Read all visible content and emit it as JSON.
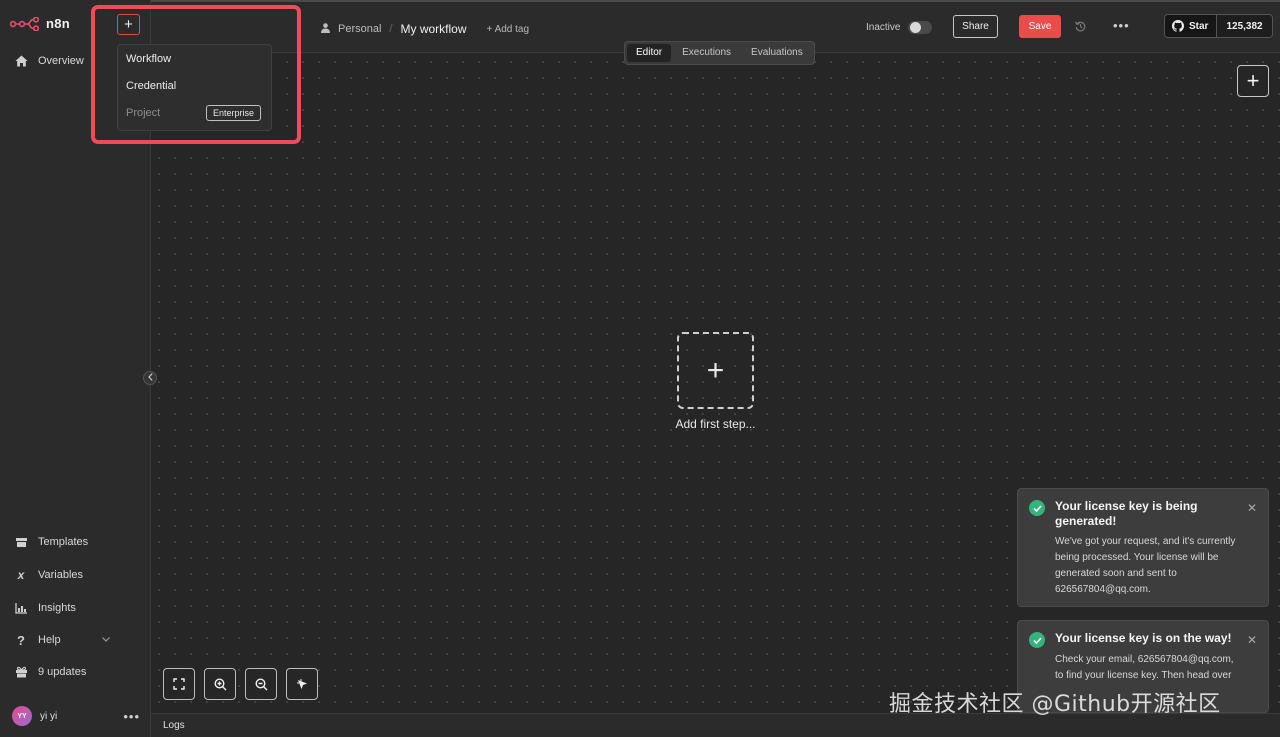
{
  "app": {
    "name": "n8n"
  },
  "sidebar": {
    "overview": "Overview",
    "bottom_items": [
      {
        "label": "Templates",
        "icon": "box-icon"
      },
      {
        "label": "Variables",
        "icon": "variable-icon"
      },
      {
        "label": "Insights",
        "icon": "chart-icon"
      },
      {
        "label": "Help",
        "icon": "help-icon"
      },
      {
        "label": "9 updates",
        "icon": "gift-icon"
      }
    ],
    "user": {
      "initials": "YY",
      "name": "yi yi"
    }
  },
  "header": {
    "project": "Personal",
    "workflow_name": "My workflow",
    "add_tag": "+ Add tag",
    "status": "Inactive",
    "share_label": "Share",
    "save_label": "Save",
    "github": {
      "label": "Star",
      "count": "125,382"
    }
  },
  "tabs": [
    {
      "label": "Editor",
      "active": true
    },
    {
      "label": "Executions",
      "active": false
    },
    {
      "label": "Evaluations",
      "active": false
    }
  ],
  "create_menu": {
    "items": [
      {
        "label": "Workflow",
        "disabled": false
      },
      {
        "label": "Credential",
        "disabled": false
      },
      {
        "label": "Project",
        "disabled": true
      }
    ],
    "project_badge": "Enterprise"
  },
  "canvas": {
    "add_first_step": "Add first step..."
  },
  "logs": {
    "label": "Logs"
  },
  "toasts": [
    {
      "title": "Your license key is being generated!",
      "body": "We've got your request, and it's currently being processed. Your license will be generated soon and sent to 626567804@qq.com."
    },
    {
      "title": "Your license key is on the way!",
      "body": "Check your email, 626567804@qq.com, to find your license key. Then head over"
    }
  ],
  "watermark": "掘金技术社区 @Github开源社区",
  "colors": {
    "accent": "#ea4b4b",
    "highlight": "#f04b57",
    "success": "#35b37e",
    "canvas_bg": "#262626"
  }
}
